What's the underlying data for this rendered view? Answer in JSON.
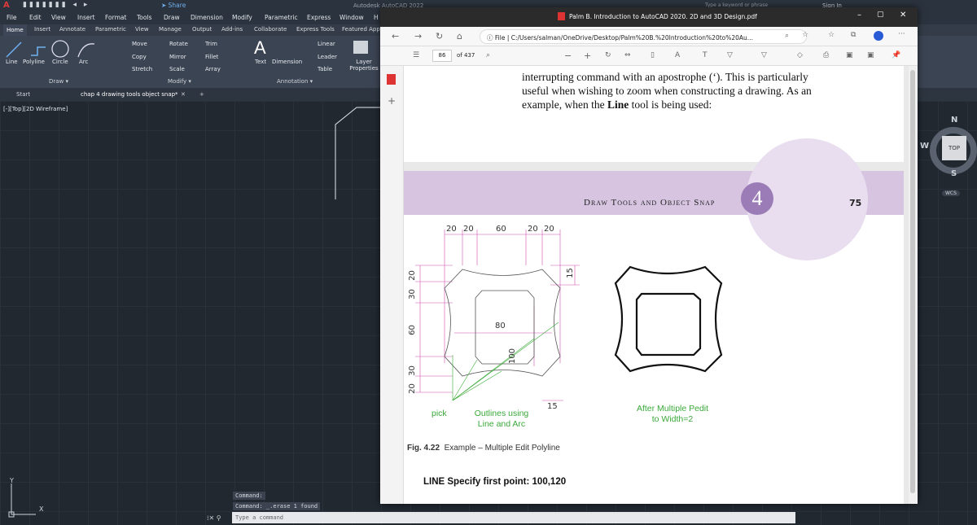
{
  "autocad": {
    "title": "Autodesk AutoCAD 2022",
    "share": "Share",
    "search_placeholder": "Type a keyword or phrase",
    "sign_in": "Sign In",
    "menu": [
      "File",
      "Edit",
      "View",
      "Insert",
      "Format",
      "Tools",
      "Draw",
      "Dimension",
      "Modify",
      "Parametric",
      "Express",
      "Window",
      "H"
    ],
    "tabs": [
      "Home",
      "Insert",
      "Annotate",
      "Parametric",
      "View",
      "Manage",
      "Output",
      "Add-ins",
      "Collaborate",
      "Express Tools",
      "Featured App"
    ],
    "ribbon": {
      "line": "Line",
      "polyline": "Polyline",
      "circle": "Circle",
      "arc": "Arc",
      "move": "Move",
      "rotate": "Rotate",
      "trim": "Trim",
      "copy": "Copy",
      "mirror": "Mirror",
      "fillet": "Fillet",
      "stretch": "Stretch",
      "scale": "Scale",
      "array": "Array",
      "text": "Text",
      "dimension": "Dimension",
      "linear": "Linear",
      "leader": "Leader",
      "table": "Table",
      "layer_properties": "Layer Properties",
      "draw_group": "Draw ▾",
      "modify_group": "Modify ▾",
      "annotation_group": "Annotation ▾"
    },
    "doc_tabs": {
      "start": "Start",
      "active": "chap 4 drawing tools object snap*"
    },
    "viewport_label": "[-][Top][2D Wireframe]",
    "viewcube": {
      "n": "N",
      "w": "W",
      "s": "S",
      "top": "TOP",
      "wcs": "WCS"
    },
    "command_history": [
      "Command:",
      "Command: _.erase 1 found"
    ],
    "command_placeholder": "Type a command",
    "ucs_y": "Y",
    "ucs_x": "X"
  },
  "browser": {
    "title": "Palm B. Introduction to AutoCAD 2020. 2D and 3D Design.pdf",
    "url_prefix": "File",
    "url": "C:/Users/salman/OneDrive/Desktop/Palm%20B.%20Introduction%20to%20Au...",
    "page_number": "86",
    "page_total": "of 437"
  },
  "pdf": {
    "page1_lines": [
      "interrupting command with an apostrophe (‘). This is particularly",
      "useful when wishing to zoom when constructing a drawing. As an"
    ],
    "page1_line3_pre": "example, when the ",
    "page1_line3_bold": "Line",
    "page1_line3_post": " tool is being used:",
    "header": "Draw Tools and Object Snap",
    "chapter": "4",
    "page": "75",
    "dims_top": [
      "20",
      "20",
      "60",
      "20",
      "20"
    ],
    "dims_left": [
      "20",
      "30",
      "60",
      "30",
      "20"
    ],
    "dim_right": "15",
    "dim_bottom": "15",
    "dim_inner_w": "80",
    "dim_inner_h": "100",
    "pick": "pick",
    "outlines": [
      "Outlines using",
      "Line and Arc"
    ],
    "after": [
      "After Multiple Pedit",
      "to Width=2"
    ],
    "fig_label": "Fig. 4.22",
    "fig_caption": "Example – Multiple Edit Polyline",
    "line_spec": "LINE Specify first point: 100,120"
  }
}
